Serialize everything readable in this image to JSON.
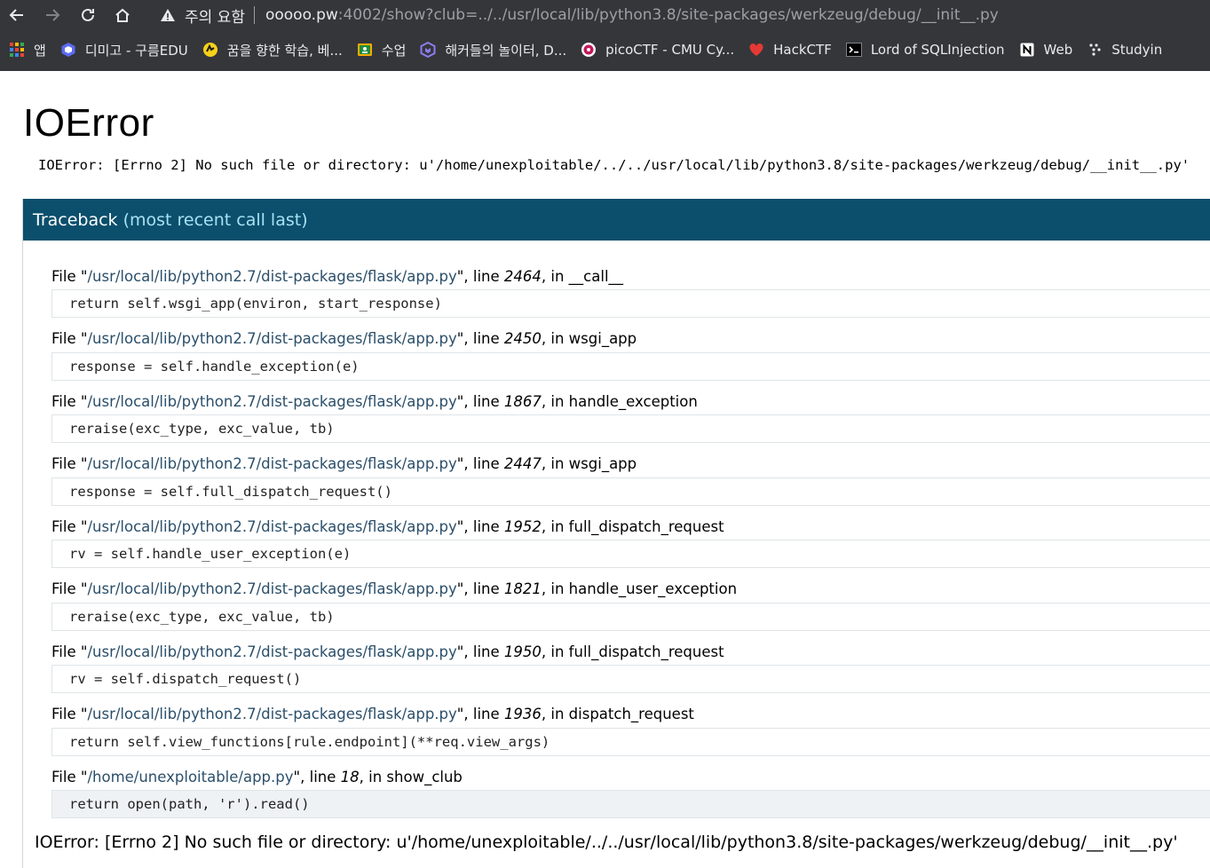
{
  "browser": {
    "security_label": "주의 요함",
    "url_host": "ooooo.pw",
    "url_path": ":4002/show?club=../../usr/local/lib/python3.8/site-packages/werkzeug/debug/__init__.py",
    "bookmarks": [
      {
        "label": "앱",
        "icon": "apps-grid-icon"
      },
      {
        "label": "디미고 - 구름EDU",
        "icon": "goorm-icon"
      },
      {
        "label": "꿈을 향한 학습, 베...",
        "icon": "study-icon"
      },
      {
        "label": "수업",
        "icon": "classroom-icon"
      },
      {
        "label": "해커들의 놀이터, D...",
        "icon": "dreamhack-icon"
      },
      {
        "label": "picoCTF - CMU Cy...",
        "icon": "picoctf-icon"
      },
      {
        "label": "HackCTF",
        "icon": "heart-icon"
      },
      {
        "label": "Lord of SQLInjection",
        "icon": "terminal-icon"
      },
      {
        "label": "Web",
        "icon": "notion-icon"
      },
      {
        "label": "Studyin",
        "icon": "dots-icon"
      }
    ]
  },
  "page": {
    "title": "IOError",
    "error_message": "IOError: [Errno 2] No such file or directory: u'/home/unexploitable/../../usr/local/lib/python3.8/site-packages/werkzeug/debug/__init__.py'",
    "traceback_title": "Traceback",
    "traceback_subtitle": "(most recent call last)"
  },
  "frames": [
    {
      "file": "/usr/local/lib/python2.7/dist-packages/flask/app.py",
      "line": "2464",
      "func": "__call__",
      "code": "return self.wsgi_app(environ, start_response)"
    },
    {
      "file": "/usr/local/lib/python2.7/dist-packages/flask/app.py",
      "line": "2450",
      "func": "wsgi_app",
      "code": "response = self.handle_exception(e)"
    },
    {
      "file": "/usr/local/lib/python2.7/dist-packages/flask/app.py",
      "line": "1867",
      "func": "handle_exception",
      "code": "reraise(exc_type, exc_value, tb)"
    },
    {
      "file": "/usr/local/lib/python2.7/dist-packages/flask/app.py",
      "line": "2447",
      "func": "wsgi_app",
      "code": "response = self.full_dispatch_request()"
    },
    {
      "file": "/usr/local/lib/python2.7/dist-packages/flask/app.py",
      "line": "1952",
      "func": "full_dispatch_request",
      "code": "rv = self.handle_user_exception(e)"
    },
    {
      "file": "/usr/local/lib/python2.7/dist-packages/flask/app.py",
      "line": "1821",
      "func": "handle_user_exception",
      "code": "reraise(exc_type, exc_value, tb)"
    },
    {
      "file": "/usr/local/lib/python2.7/dist-packages/flask/app.py",
      "line": "1950",
      "func": "full_dispatch_request",
      "code": "rv = self.dispatch_request()"
    },
    {
      "file": "/usr/local/lib/python2.7/dist-packages/flask/app.py",
      "line": "1936",
      "func": "dispatch_request",
      "code": "return self.view_functions[rule.endpoint](**req.view_args)"
    },
    {
      "file": "/home/unexploitable/app.py",
      "line": "18",
      "func": "show_club",
      "code": "return open(path, 'r').read()"
    }
  ],
  "frame_labels": {
    "file_prefix": "File ",
    "line_prefix": ", line ",
    "in_prefix": ", in "
  },
  "colors": {
    "chrome": "#35363a",
    "traceback_header": "#0b4f6c",
    "traceback_subtitle": "#a8e1f3"
  }
}
